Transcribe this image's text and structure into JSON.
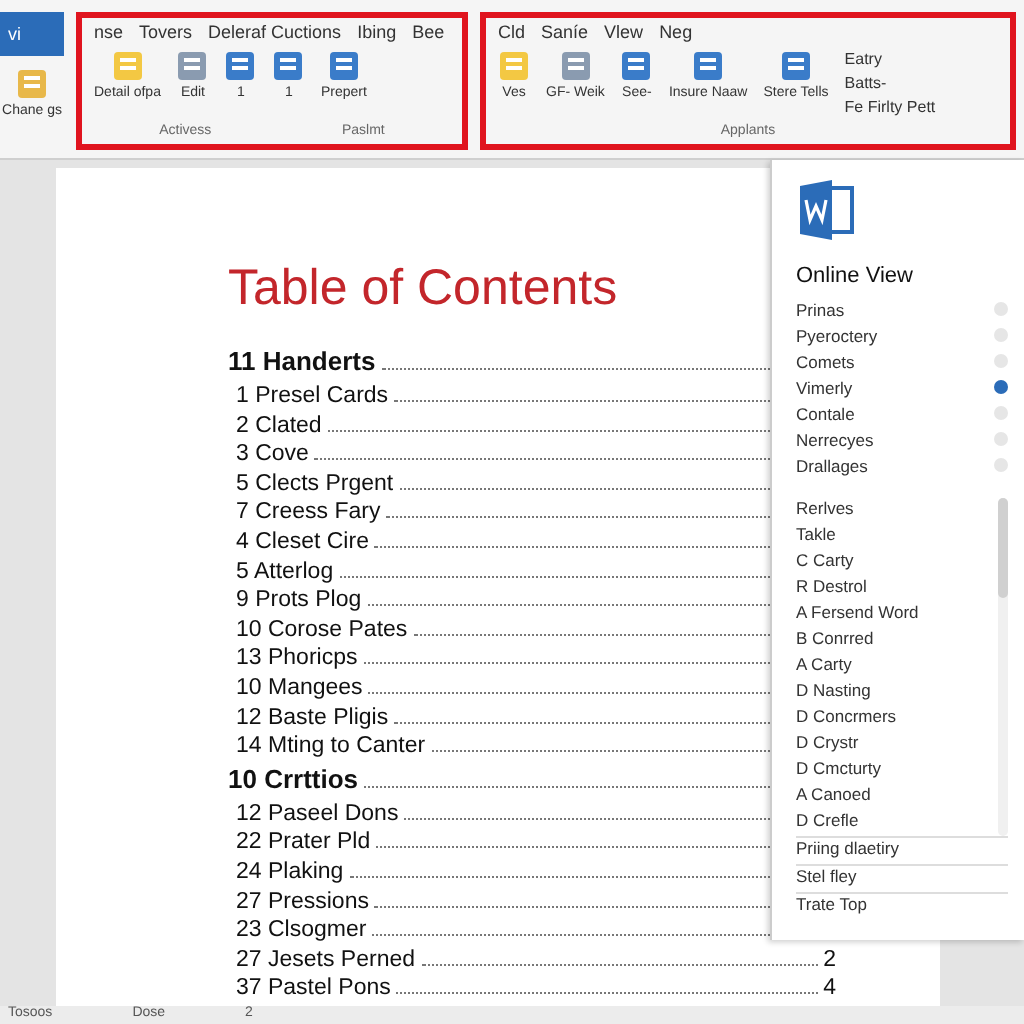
{
  "file_tab": "vi",
  "paste_button": "Chane gs",
  "ribbon_groups": [
    {
      "highlighted": true,
      "tabs": [
        "nse",
        "Tovers",
        "Deleraf Cuctions",
        "Ibing",
        "Bee"
      ],
      "label": "Activess",
      "buttons": [
        {
          "kind": "large",
          "label": "Detail ofpa"
        },
        {
          "kind": "small",
          "label": "Edit"
        },
        {
          "kind": "icon",
          "label": "1"
        },
        {
          "kind": "icon",
          "label": "1"
        },
        {
          "kind": "icon",
          "label": "Prepert"
        }
      ],
      "label2": "Paslmt"
    },
    {
      "highlighted": true,
      "tabs": [
        "Cld",
        "Saníe",
        "Vlew",
        "Neg"
      ],
      "label": "Applants",
      "buttons": [
        {
          "kind": "large",
          "label": "Ves"
        },
        {
          "kind": "small",
          "label": "GF- Weik"
        },
        {
          "kind": "icon",
          "label": "See-"
        },
        {
          "kind": "icon",
          "label": "Insure Naaw"
        },
        {
          "kind": "icon",
          "label": "Stere Tells"
        }
      ],
      "list": [
        "Eatry",
        "Batts-",
        "Fe Firlty Pett"
      ]
    }
  ],
  "document": {
    "title": "Table of Contents",
    "entries": [
      {
        "kind": "heading",
        "text": "11 Handerts"
      },
      {
        "kind": "entry",
        "text": "1 Presel Cards"
      },
      {
        "kind": "entry",
        "text": "2 Clated"
      },
      {
        "kind": "entry",
        "text": "3 Cove"
      },
      {
        "kind": "entry",
        "text": "5 Clects Prgent"
      },
      {
        "kind": "entry",
        "text": "7 Creess Fary"
      },
      {
        "kind": "entry",
        "text": "4 Cleset Cire"
      },
      {
        "kind": "entry",
        "text": "5 Atterlog"
      },
      {
        "kind": "entry",
        "text": "9 Prots Plog"
      },
      {
        "kind": "entry",
        "text": "10 Corose Pates"
      },
      {
        "kind": "entry",
        "text": "13 Phoricps"
      },
      {
        "kind": "entry",
        "text": "10 Mangees"
      },
      {
        "kind": "entry",
        "text": "12 Baste Pligis"
      },
      {
        "kind": "entry",
        "text": "14 Mting to Canter"
      },
      {
        "kind": "heading",
        "text": "10 Crrttios"
      },
      {
        "kind": "entry",
        "text": "12 Paseel Dons"
      },
      {
        "kind": "entry",
        "text": "22 Prater Pld"
      },
      {
        "kind": "entry",
        "text": "24 Plaking"
      },
      {
        "kind": "entry",
        "text": "27 Pressions"
      },
      {
        "kind": "entry",
        "text": "23 Clsogmer"
      },
      {
        "kind": "entry",
        "text": "27 Jesets Perned",
        "page": "2"
      },
      {
        "kind": "entry",
        "text": "37 Pastel Pons",
        "page": "4"
      }
    ]
  },
  "panel": {
    "heading": "Online View",
    "options": [
      {
        "label": "Prinas",
        "selected": false
      },
      {
        "label": "Pyeroctery",
        "selected": false
      },
      {
        "label": "Comets",
        "selected": false
      },
      {
        "label": "Vimerly",
        "selected": true
      },
      {
        "label": "Contale",
        "selected": false
      },
      {
        "label": "Nerrecyes",
        "selected": false
      },
      {
        "label": "Drallages",
        "selected": false
      }
    ],
    "list": [
      "Rerlves",
      "Takle",
      "C Carty",
      "R Destrol",
      "A Fersend Word",
      "B Conrred",
      "A Carty",
      "D Nasting",
      "D Concrmers",
      "D Crystr",
      "D Cmcturty",
      "A Canoed",
      "D Crefle"
    ],
    "footer": [
      "Priing dlaetiry",
      "Stel fley",
      "Trate Top"
    ]
  },
  "status_bar": [
    "Tosoos",
    "Dose",
    "2"
  ]
}
